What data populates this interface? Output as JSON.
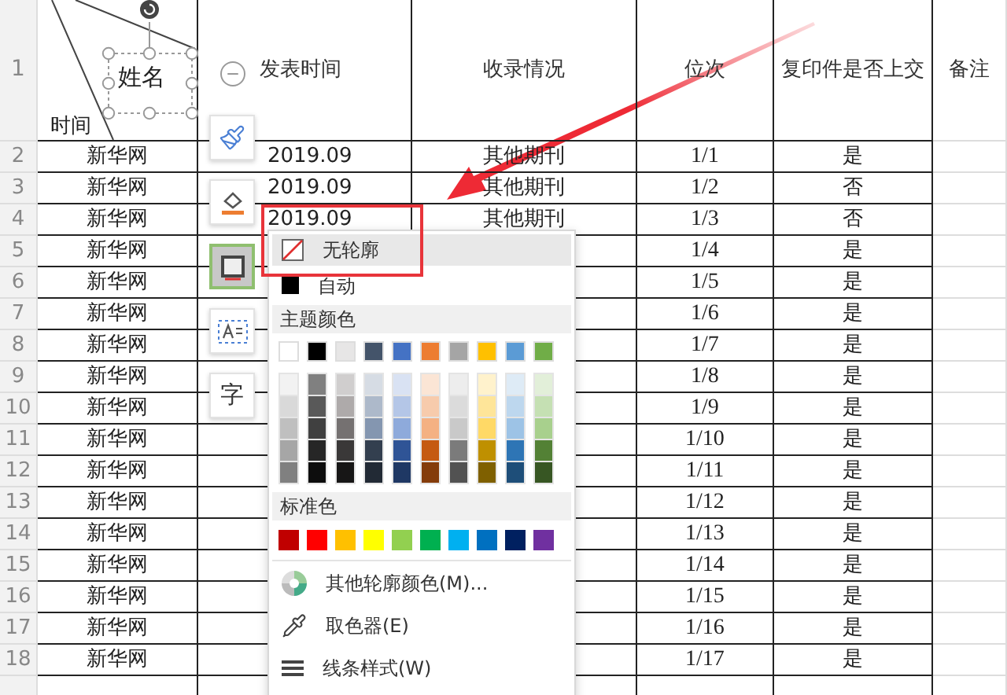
{
  "header": {
    "row": "1",
    "name_cell": {
      "top_label": "姓名",
      "bottom_label": "时间"
    },
    "columns": [
      "发表时间",
      "收录情况",
      "位次",
      "复印件是否上交",
      "备注"
    ]
  },
  "rows": [
    {
      "row": "2",
      "name": "新华网",
      "date": "2019.09",
      "inclusion": "其他期刊",
      "rank": "1/1",
      "copy": "是"
    },
    {
      "row": "3",
      "name": "新华网",
      "date": "2019.09",
      "inclusion": "其他期刊",
      "rank": "1/2",
      "copy": "否"
    },
    {
      "row": "4",
      "name": "新华网",
      "date": "2019.09",
      "inclusion": "其他期刊",
      "rank": "1/3",
      "copy": "否"
    },
    {
      "row": "5",
      "name": "新华网",
      "rank": "1/4",
      "copy": "是"
    },
    {
      "row": "6",
      "name": "新华网",
      "rank": "1/5",
      "copy": "是"
    },
    {
      "row": "7",
      "name": "新华网",
      "rank": "1/6",
      "copy": "是"
    },
    {
      "row": "8",
      "name": "新华网",
      "rank": "1/7",
      "copy": "是"
    },
    {
      "row": "9",
      "name": "新华网",
      "rank": "1/8",
      "copy": "是"
    },
    {
      "row": "10",
      "name": "新华网",
      "rank": "1/9",
      "copy": "是"
    },
    {
      "row": "11",
      "name": "新华网",
      "rank": "1/10",
      "copy": "是"
    },
    {
      "row": "12",
      "name": "新华网",
      "rank": "1/11",
      "copy": "是"
    },
    {
      "row": "13",
      "name": "新华网",
      "rank": "1/12",
      "copy": "是"
    },
    {
      "row": "14",
      "name": "新华网",
      "rank": "1/13",
      "copy": "是"
    },
    {
      "row": "15",
      "name": "新华网",
      "rank": "1/14",
      "copy": "是"
    },
    {
      "row": "16",
      "name": "新华网",
      "rank": "1/15",
      "copy": "是"
    },
    {
      "row": "17",
      "name": "新华网",
      "rank": "1/16",
      "copy": "是"
    },
    {
      "row": "18",
      "name": "新华网",
      "rank": "1/17",
      "copy": "是"
    }
  ],
  "float_toolbar": [
    {
      "kind": "minus",
      "selected": false
    },
    {
      "kind": "brush",
      "selected": false
    },
    {
      "kind": "fill",
      "selected": false
    },
    {
      "kind": "outline",
      "selected": true
    },
    {
      "kind": "textbox",
      "selected": false
    },
    {
      "kind": "glyph",
      "label": "字",
      "selected": false
    }
  ],
  "outline_menu": {
    "no_outline": {
      "label": "无轮廓",
      "highlighted": true
    },
    "auto": {
      "label": "自动",
      "color": "#000000",
      "highlighted": false
    },
    "theme_heading": "主题颜色",
    "theme_colors": [
      {
        "color": "#ffffff",
        "shades": [
          {
            "color": "#f2f2f2"
          },
          {
            "color": "#d9d9d9"
          },
          {
            "color": "#bfbfbf"
          },
          {
            "color": "#a6a6a6"
          },
          {
            "color": "#808080"
          }
        ]
      },
      {
        "color": "#000000",
        "shades": [
          {
            "color": "#808080"
          },
          {
            "color": "#595959"
          },
          {
            "color": "#404040"
          },
          {
            "color": "#262626"
          },
          {
            "color": "#0d0d0d"
          }
        ]
      },
      {
        "color": "#e7e6e6",
        "shades": [
          {
            "color": "#d0cece"
          },
          {
            "color": "#aeaaaa"
          },
          {
            "color": "#757171"
          },
          {
            "color": "#3a3838"
          },
          {
            "color": "#171616"
          }
        ]
      },
      {
        "color": "#44546a",
        "shades": [
          {
            "color": "#d6dce4"
          },
          {
            "color": "#adb9ca"
          },
          {
            "color": "#8496b0"
          },
          {
            "color": "#333f4f"
          },
          {
            "color": "#222a35"
          }
        ]
      },
      {
        "color": "#4472c4",
        "shades": [
          {
            "color": "#d9e2f3"
          },
          {
            "color": "#b4c6e7"
          },
          {
            "color": "#8eaadb"
          },
          {
            "color": "#2f5496"
          },
          {
            "color": "#1f3864"
          }
        ]
      },
      {
        "color": "#ed7d31",
        "shades": [
          {
            "color": "#fbe5d5"
          },
          {
            "color": "#f7cbac"
          },
          {
            "color": "#f4b183"
          },
          {
            "color": "#c55a11"
          },
          {
            "color": "#843c0b"
          }
        ]
      },
      {
        "color": "#a5a5a5",
        "shades": [
          {
            "color": "#ededed"
          },
          {
            "color": "#dbdbdb"
          },
          {
            "color": "#c9c9c9"
          },
          {
            "color": "#7b7b7b"
          },
          {
            "color": "#525252"
          }
        ]
      },
      {
        "color": "#ffc000",
        "shades": [
          {
            "color": "#fff2cc"
          },
          {
            "color": "#fee599"
          },
          {
            "color": "#ffd966"
          },
          {
            "color": "#bf9000"
          },
          {
            "color": "#7f6000"
          }
        ]
      },
      {
        "color": "#5b9bd5",
        "shades": [
          {
            "color": "#deebf6"
          },
          {
            "color": "#bdd7ee"
          },
          {
            "color": "#9dc3e6"
          },
          {
            "color": "#2e75b5"
          },
          {
            "color": "#1e4e79"
          }
        ]
      },
      {
        "color": "#70ad47",
        "shades": [
          {
            "color": "#e2efd9"
          },
          {
            "color": "#c5e0b3"
          },
          {
            "color": "#a8d08d"
          },
          {
            "color": "#538135"
          },
          {
            "color": "#375623"
          }
        ]
      }
    ],
    "standard_heading": "标准色",
    "standard_colors": [
      {
        "color": "#c00000"
      },
      {
        "color": "#ff0000"
      },
      {
        "color": "#ffc000"
      },
      {
        "color": "#ffff00"
      },
      {
        "color": "#92d050"
      },
      {
        "color": "#00b050"
      },
      {
        "color": "#00b0f0"
      },
      {
        "color": "#0070c0"
      },
      {
        "color": "#002060"
      },
      {
        "color": "#7030a0"
      }
    ],
    "actions": [
      {
        "kind": "more-colors",
        "label": "其他轮廓颜色(M)..."
      },
      {
        "kind": "eyedropper",
        "label": "取色器(E)"
      },
      {
        "kind": "line-style",
        "label": "线条样式(W)"
      }
    ]
  }
}
